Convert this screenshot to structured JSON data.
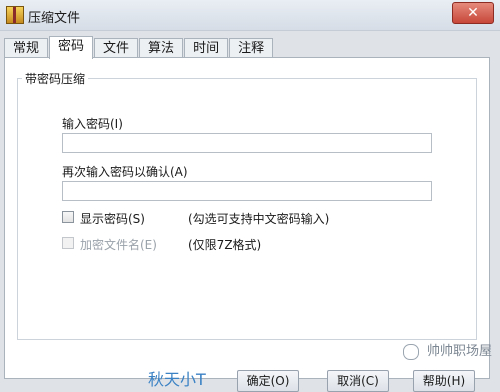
{
  "window": {
    "title": "压缩文件",
    "close_glyph": "✕"
  },
  "tabs": [
    {
      "label": "常规"
    },
    {
      "label": "密码"
    },
    {
      "label": "文件"
    },
    {
      "label": "算法"
    },
    {
      "label": "时间"
    },
    {
      "label": "注释"
    }
  ],
  "group": {
    "title": "带密码压缩",
    "password_label": "输入密码(I)",
    "password_value": "",
    "confirm_label": "再次输入密码以确认(A)",
    "confirm_value": "",
    "show_password_label": "显示密码(S)",
    "show_password_hint": "(勾选可支持中文密码输入)",
    "encrypt_names_label": "加密文件名(E)",
    "encrypt_names_hint": "(仅限7Z格式)"
  },
  "buttons": {
    "ok": "确定(O)",
    "cancel": "取消(C)",
    "help": "帮助(H)"
  },
  "watermark": {
    "text": "帅帅职场屋",
    "overlay_text": "秋天小T"
  }
}
